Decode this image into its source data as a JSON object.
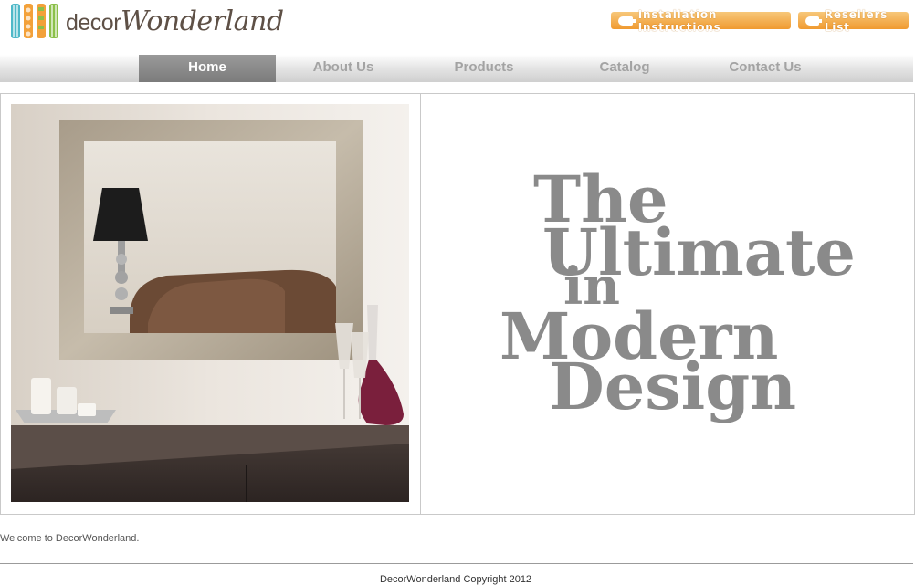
{
  "brand": {
    "name_part1": "decor",
    "name_part2": "Wonderland",
    "colors": [
      "#4fb8c8",
      "#f3a13a",
      "#8cc04a"
    ]
  },
  "header": {
    "install_button": "Installation Instructions",
    "resellers_button": "Resellers List"
  },
  "nav": {
    "items": [
      {
        "label": "Home",
        "active": true
      },
      {
        "label": "About Us",
        "active": false
      },
      {
        "label": "Products",
        "active": false
      },
      {
        "label": "Catalog",
        "active": false
      },
      {
        "label": "Contact Us",
        "active": false
      }
    ]
  },
  "hero": {
    "tagline_lines": [
      "The",
      "Ultimate",
      "in",
      "Modern",
      "Design"
    ],
    "tagline_color": "#8a8a8a"
  },
  "content": {
    "welcome": "Welcome to DecorWonderland."
  },
  "footer": {
    "copyright": "DecorWonderland Copyright 2012"
  }
}
